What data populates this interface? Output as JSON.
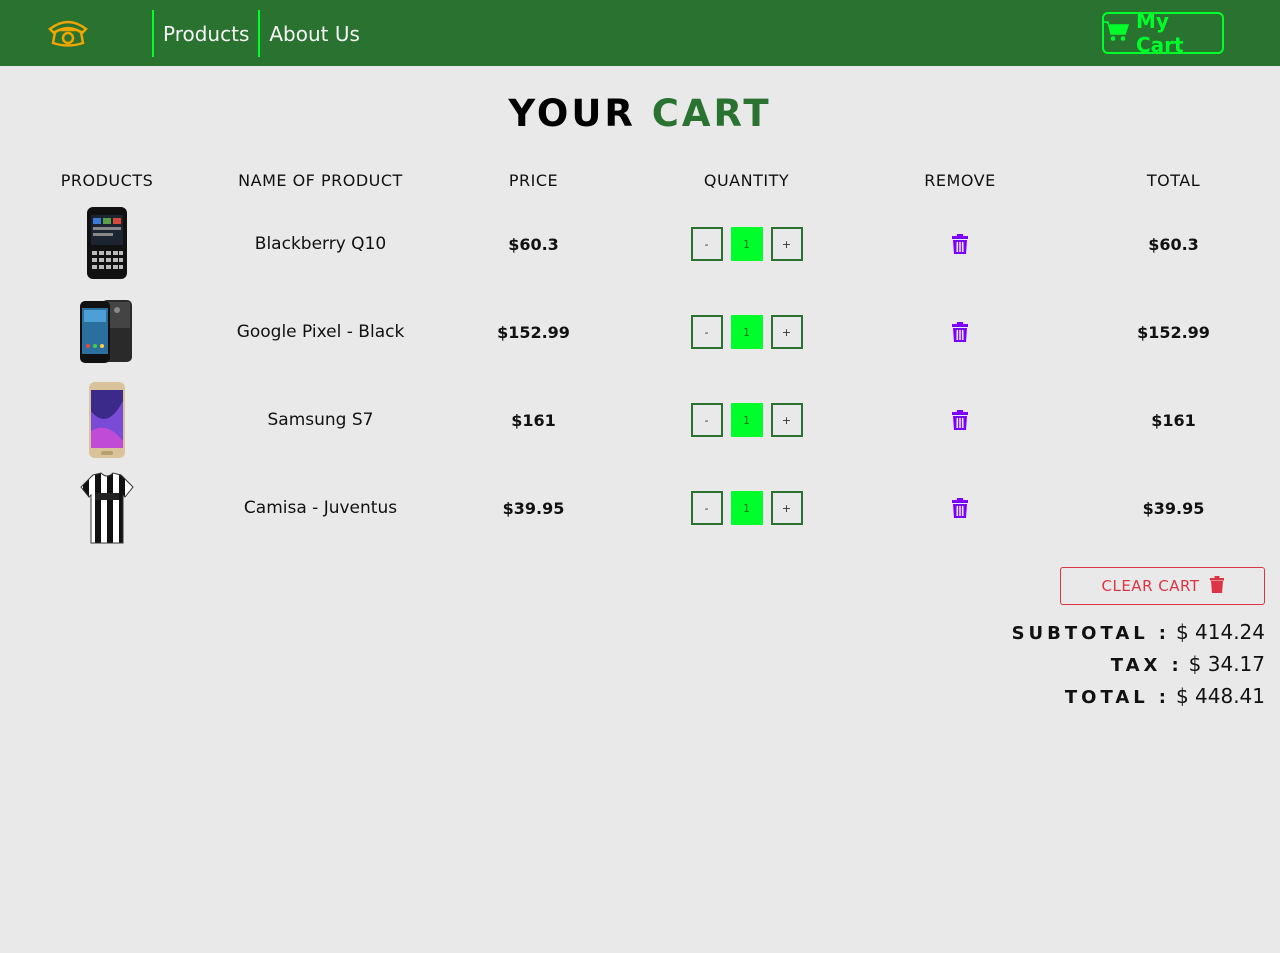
{
  "navbar": {
    "links": [
      "Products",
      "About Us"
    ],
    "cart_label": "My Cart",
    "logo_icon": "phone-icon",
    "cart_icon": "cart-icon"
  },
  "title": {
    "word1": "YOUR",
    "word2": "CART"
  },
  "table": {
    "headers": [
      "PRODUCTS",
      "NAME OF PRODUCT",
      "PRICE",
      "QUANTITY",
      "REMOVE",
      "TOTAL"
    ],
    "rows": [
      {
        "name": "Blackberry Q10",
        "price": "$60.3",
        "qty": "1",
        "total": "$60.3"
      },
      {
        "name": "Google Pixel - Black",
        "price": "$152.99",
        "qty": "1",
        "total": "$152.99"
      },
      {
        "name": "Samsung S7",
        "price": "$161",
        "qty": "1",
        "total": "$161"
      },
      {
        "name": "Camisa - Juventus",
        "price": "$39.95",
        "qty": "1",
        "total": "$39.95"
      }
    ],
    "minus": "-",
    "plus": "+"
  },
  "summary": {
    "clear_label": "CLEAR CART",
    "subtotal_label": "SUBTOTAL",
    "subtotal_value": "$ 414.24",
    "tax_label": "TAX",
    "tax_value": "$ 34.17",
    "total_label": "TOTAL",
    "total_value": "$ 448.41",
    "colon": ":"
  },
  "colors": {
    "navbar": "#2a7230",
    "accent": "#00ff2a",
    "trash": "#7b00ff",
    "danger": "#dc3545",
    "logo": "#f0a500"
  }
}
